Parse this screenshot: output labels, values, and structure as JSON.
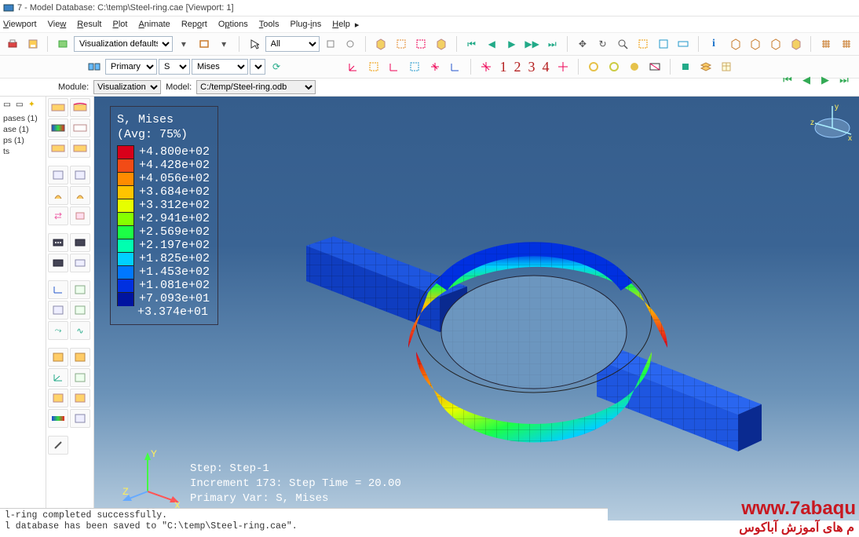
{
  "title": "7 - Model Database: C:\\temp\\Steel-ring.cae [Viewport: 1]",
  "menu": [
    "Viewport",
    "View",
    "Result",
    "Plot",
    "Animate",
    "Report",
    "Options",
    "Tools",
    "Plug-ins",
    "Help"
  ],
  "toolbar1": {
    "vis_defaults": "Visualization defaults",
    "selection": "All"
  },
  "toolbar2": {
    "primary": "Primary",
    "pos": "S",
    "invariant": "Mises"
  },
  "module": {
    "label_module": "Module:",
    "module_val": "Visualization",
    "label_model": "Model:",
    "model_val": "C:/temp/Steel-ring.odb"
  },
  "tree": {
    "header_icons": [
      "view",
      "filter",
      "bulb"
    ],
    "items": [
      "pases (1)",
      "ase (1)",
      "",
      "",
      "ps (1)",
      "ts"
    ]
  },
  "legend": {
    "title1": "S, Mises",
    "title2": "(Avg: 75%)",
    "rows": [
      {
        "c": "#d8001a",
        "v": "+4.800e+02"
      },
      {
        "c": "#f24b16",
        "v": "+4.428e+02"
      },
      {
        "c": "#ff8c00",
        "v": "+4.056e+02"
      },
      {
        "c": "#ffc400",
        "v": "+3.684e+02"
      },
      {
        "c": "#e6ff00",
        "v": "+3.312e+02"
      },
      {
        "c": "#86ff00",
        "v": "+2.941e+02"
      },
      {
        "c": "#1cff46",
        "v": "+2.569e+02"
      },
      {
        "c": "#00ffb0",
        "v": "+2.197e+02"
      },
      {
        "c": "#00d0ff",
        "v": "+1.825e+02"
      },
      {
        "c": "#0078ff",
        "v": "+1.453e+02"
      },
      {
        "c": "#0030e0",
        "v": "+1.081e+02"
      },
      {
        "c": "#0014a0",
        "v": "+7.093e+01"
      },
      {
        "c": "",
        "v": "+3.374e+01"
      }
    ]
  },
  "status": {
    "line1": "Step: Step-1",
    "line2": "Increment   173: Step Time =   20.00",
    "line3": "Primary Var: S, Mises"
  },
  "triad": {
    "x": "X",
    "y": "Y",
    "z": "Z"
  },
  "compass": {
    "x": "x",
    "y": "y",
    "z": "z"
  },
  "msgs": {
    "l1": "l-ring completed successfully.",
    "l2": "l database has been saved to \"C:\\temp\\Steel-ring.cae\"."
  },
  "watermark": "www.7abaqu",
  "watermark2": "م های آموزش آباکوس",
  "bignums": [
    "1",
    "2",
    "3",
    "4"
  ]
}
